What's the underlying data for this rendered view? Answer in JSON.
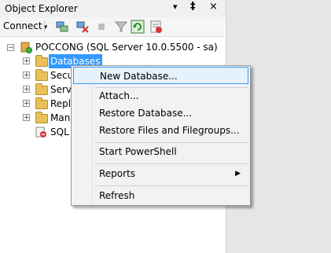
{
  "window": {
    "title": "Object Explorer",
    "pin_label": "▾",
    "pin_icon": "‡",
    "close_icon": "×"
  },
  "toolbar": {
    "connect_label": "Connect",
    "connect_arrow": "▾"
  },
  "tree": {
    "server": "POCCONG (SQL Server 10.0.5500 - sa)",
    "items": [
      "Databases",
      "Secu",
      "Serve",
      "Repli",
      "Mana",
      "SQL S"
    ]
  },
  "menu": {
    "items": [
      "New Database...",
      "Attach...",
      "Restore Database...",
      "Restore Files and Filegroups...",
      "Start PowerShell",
      "Reports",
      "Refresh"
    ],
    "submenu_arrow": "▶"
  },
  "colors": {
    "selection": "#3399ff",
    "menu_bg": "#f2f2f2",
    "folder": "#e8c15a"
  }
}
